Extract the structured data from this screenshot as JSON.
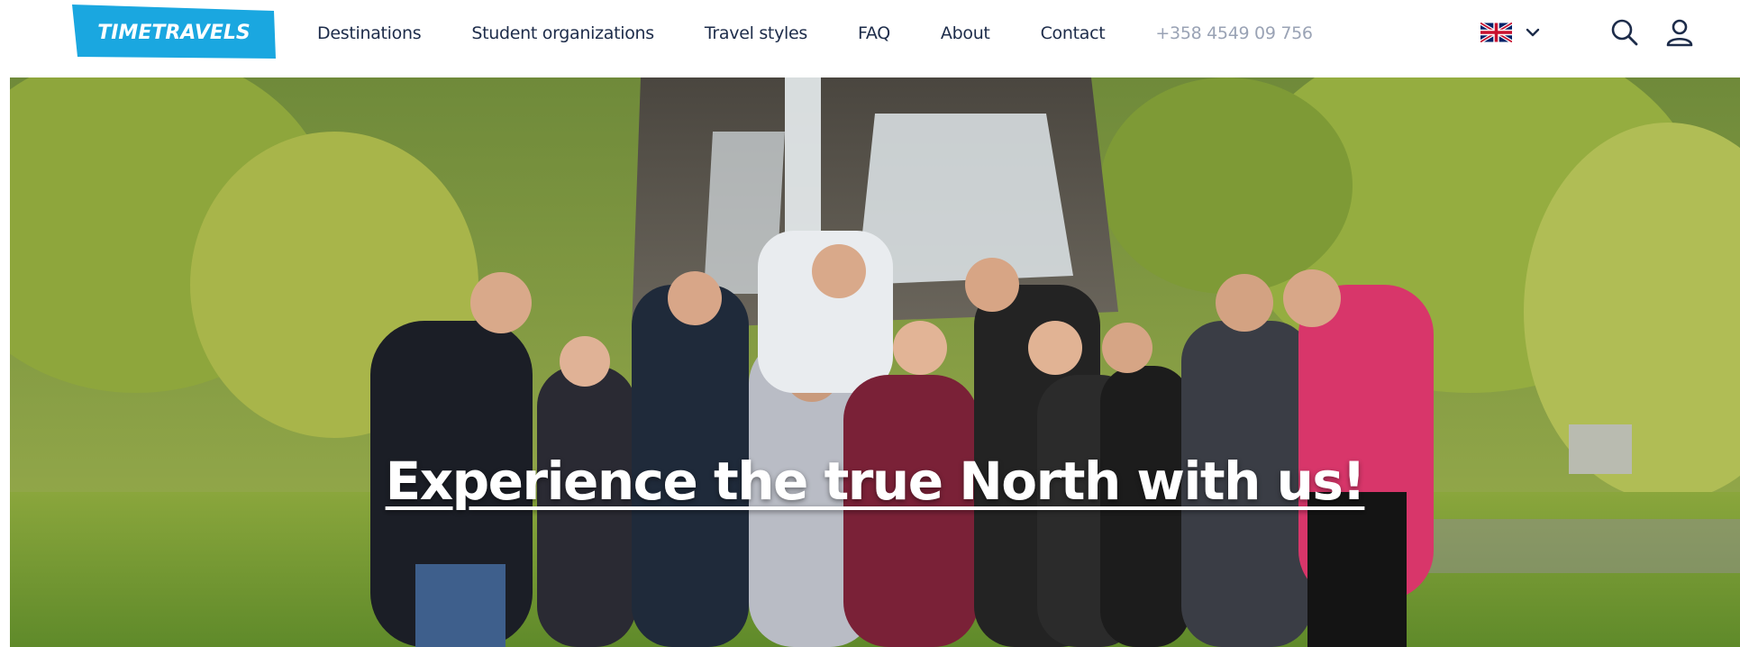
{
  "header": {
    "logo_text": "TIMETRAVELS",
    "nav": [
      {
        "label": "Destinations"
      },
      {
        "label": "Student organizations"
      },
      {
        "label": "Travel styles"
      },
      {
        "label": "FAQ"
      },
      {
        "label": "About"
      },
      {
        "label": "Contact"
      }
    ],
    "phone": "+358 4549 09 756",
    "language_flag": "uk-flag-icon",
    "icons": [
      "chevron-down-icon",
      "search-icon",
      "user-icon"
    ]
  },
  "hero": {
    "headline": "Experience the true North with us!"
  },
  "colors": {
    "brand": "#1aa7e0",
    "nav_text": "#1d2c4a",
    "phone_text": "#9aa3b5"
  }
}
